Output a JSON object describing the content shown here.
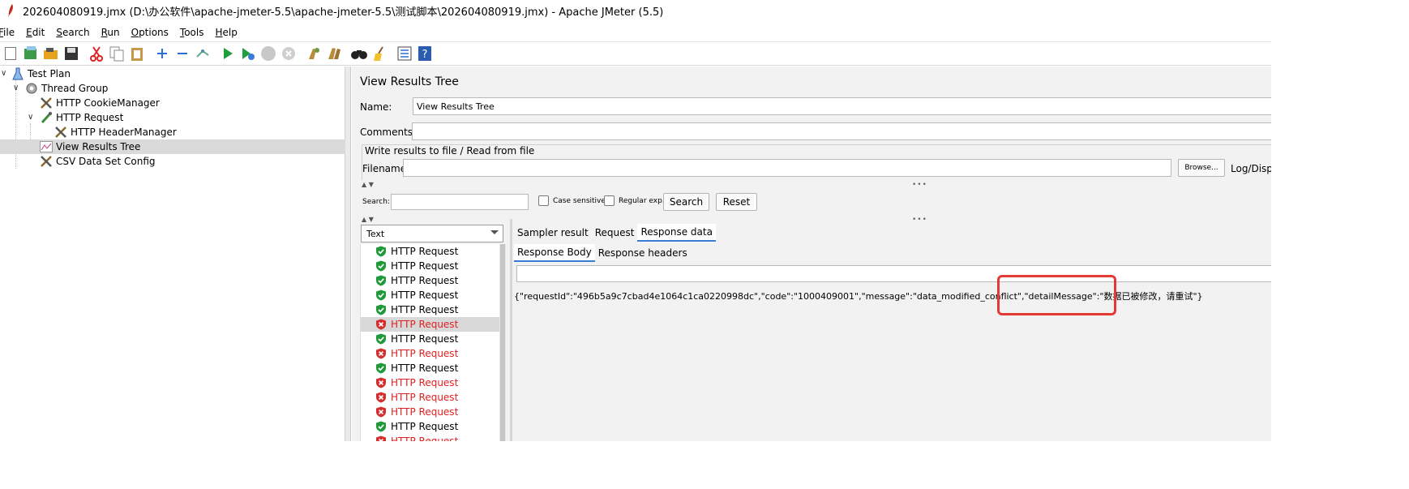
{
  "window": {
    "title": "202604080919.jmx (D:\\办公软件\\apache-jmeter-5.5\\apache-jmeter-5.5\\测试脚本\\202604080919.jmx) - Apache JMeter (5.5)"
  },
  "menu": {
    "items": [
      {
        "mn": "F",
        "rest": "ile"
      },
      {
        "mn": "E",
        "rest": "dit"
      },
      {
        "mn": "S",
        "rest": "earch"
      },
      {
        "mn": "R",
        "rest": "un"
      },
      {
        "mn": "O",
        "rest": "ptions"
      },
      {
        "mn": "T",
        "rest": "ools"
      },
      {
        "mn": "H",
        "rest": "elp"
      }
    ]
  },
  "tree": {
    "nodes": [
      {
        "label": "Test Plan"
      },
      {
        "label": "Thread Group"
      },
      {
        "label": "HTTP CookieManager"
      },
      {
        "label": "HTTP Request"
      },
      {
        "label": "HTTP HeaderManager"
      },
      {
        "label": "View Results Tree"
      },
      {
        "label": "CSV Data Set Config"
      }
    ]
  },
  "panel": {
    "title": "View Results Tree",
    "name_label": "Name:",
    "name_value": "View Results Tree",
    "comments_label": "Comments:",
    "comments_value": "",
    "group_title": "Write results to file / Read from file",
    "filename_label": "Filename",
    "filename_value": "",
    "browse_label": "Browse...",
    "log_label": "Log/Displa",
    "search_label": "Search:",
    "search_value": "",
    "case_label": "Case sensitive",
    "regex_label": "Regular exp.",
    "search_button": "Search",
    "reset_button": "Reset"
  },
  "renderer": {
    "selected": "Text"
  },
  "results": [
    {
      "label": "HTTP Request",
      "status": "success"
    },
    {
      "label": "HTTP Request",
      "status": "success"
    },
    {
      "label": "HTTP Request",
      "status": "success"
    },
    {
      "label": "HTTP Request",
      "status": "success"
    },
    {
      "label": "HTTP Request",
      "status": "success"
    },
    {
      "label": "HTTP Request",
      "status": "failure"
    },
    {
      "label": "HTTP Request",
      "status": "success"
    },
    {
      "label": "HTTP Request",
      "status": "failure"
    },
    {
      "label": "HTTP Request",
      "status": "success"
    },
    {
      "label": "HTTP Request",
      "status": "failure"
    },
    {
      "label": "HTTP Request",
      "status": "failure"
    },
    {
      "label": "HTTP Request",
      "status": "failure"
    },
    {
      "label": "HTTP Request",
      "status": "success"
    },
    {
      "label": "HTTP Request",
      "status": "failure"
    }
  ],
  "detail_tabs": {
    "tabs": [
      "Sampler result",
      "Request",
      "Response data"
    ],
    "active": "Response data"
  },
  "response_tabs": {
    "tabs": [
      "Response Body",
      "Response headers"
    ],
    "active": "Response Body"
  },
  "response": {
    "body": "{\"requestId\":\"496b5a9c7cbad4e1064c1ca0220998dc\",\"code\":\"1000409001\",\"message\":\"data_modified_conflict\",\"detailMessage\":\"数据已被修改，请重试\"}"
  },
  "colors": {
    "failure_text": "#e02020",
    "annotation": "#e53935",
    "accent": "#3a7bd5"
  }
}
